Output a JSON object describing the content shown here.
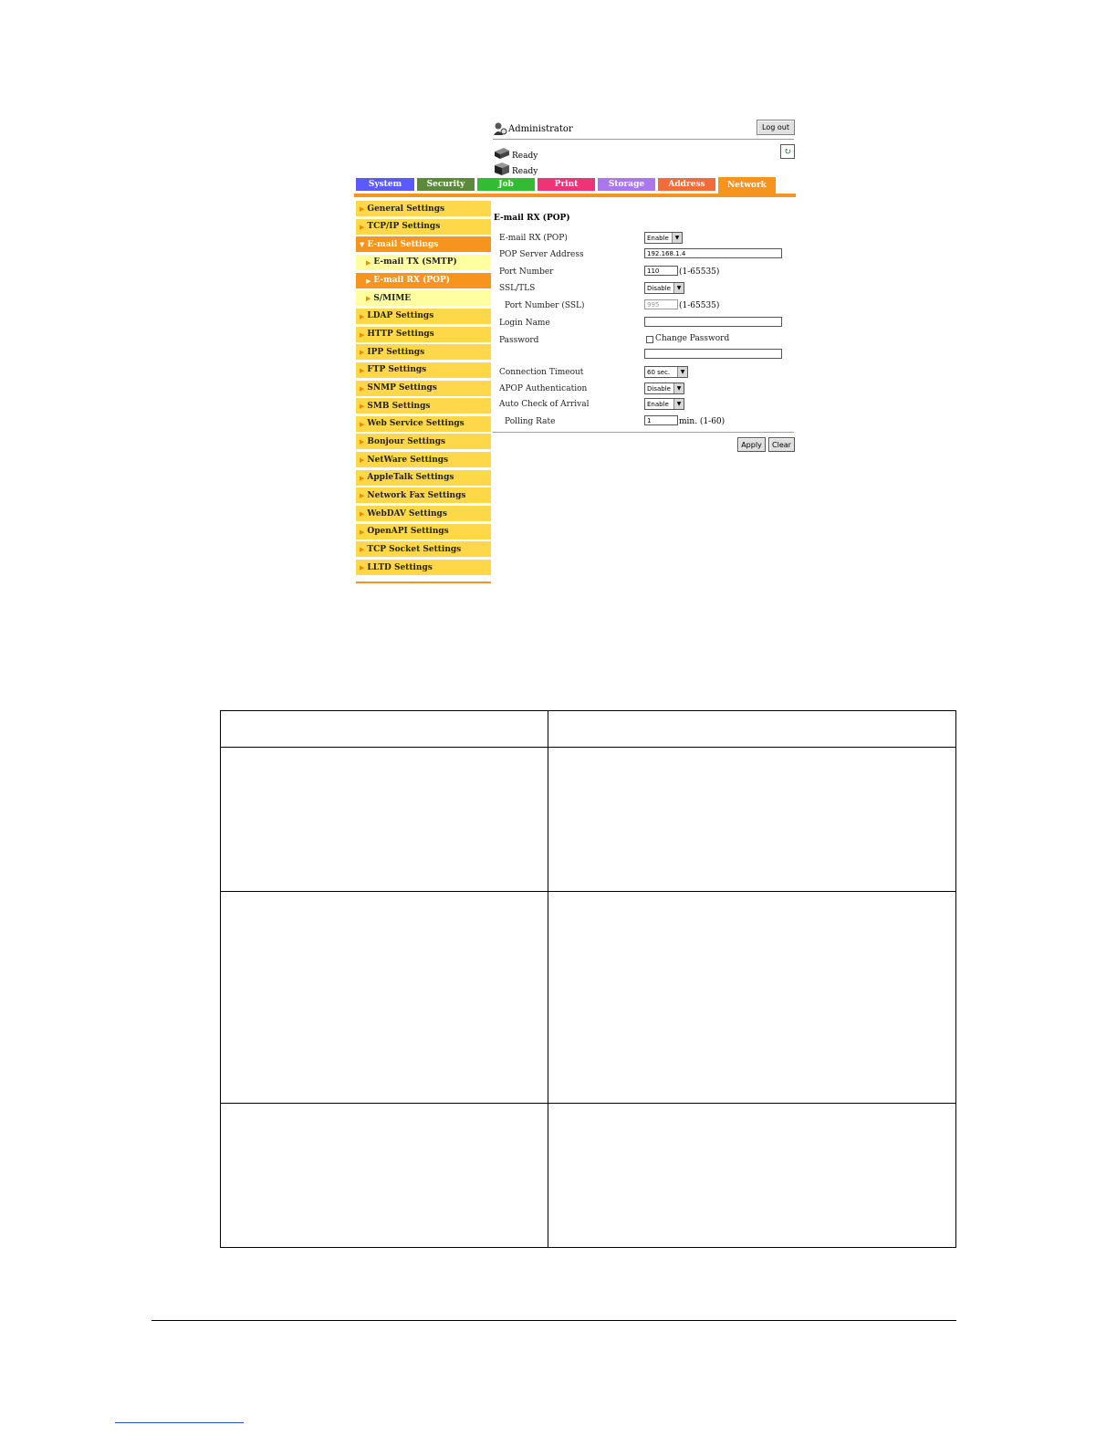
{
  "header": {
    "admin_label": "Administrator",
    "logout_label": "Log out",
    "status_printer": "Ready",
    "status_scanner": "Ready"
  },
  "tabs": [
    {
      "label": "System",
      "color": "#5a5aff"
    },
    {
      "label": "Security",
      "color": "#5a8a3a"
    },
    {
      "label": "Job",
      "color": "#33bb33"
    },
    {
      "label": "Print",
      "color": "#ee3377"
    },
    {
      "label": "Storage",
      "color": "#aa77ee"
    },
    {
      "label": "Address",
      "color": "#f26b3a"
    },
    {
      "label": "Network",
      "color": "#f7941d",
      "active": true
    }
  ],
  "sidebar": {
    "items": [
      {
        "label": "General Settings"
      },
      {
        "label": "TCP/IP Settings"
      },
      {
        "label": "E-mail Settings",
        "open": true
      },
      {
        "label": "E-mail TX (SMTP)",
        "sub": true
      },
      {
        "label": "E-mail RX (POP)",
        "sub": true,
        "active": true
      },
      {
        "label": "S/MIME",
        "sub": true
      },
      {
        "label": "LDAP Settings"
      },
      {
        "label": "HTTP Settings"
      },
      {
        "label": "IPP Settings"
      },
      {
        "label": "FTP Settings"
      },
      {
        "label": "SNMP Settings"
      },
      {
        "label": "SMB Settings"
      },
      {
        "label": "Web Service Settings"
      },
      {
        "label": "Bonjour Settings"
      },
      {
        "label": "NetWare Settings"
      },
      {
        "label": "AppleTalk Settings"
      },
      {
        "label": "Network Fax Settings"
      },
      {
        "label": "WebDAV Settings"
      },
      {
        "label": "OpenAPI Settings"
      },
      {
        "label": "TCP Socket Settings"
      },
      {
        "label": "LLTD Settings"
      }
    ]
  },
  "form": {
    "title": "E-mail RX (POP)",
    "email_rx_label": "E-mail RX (POP)",
    "email_rx_value": "Enable",
    "pop_server_label": "POP Server Address",
    "pop_server_value": "192.168.1.4",
    "port_label": "Port Number",
    "port_value": "110",
    "port_range": "(1-65535)",
    "ssl_label": "SSL/TLS",
    "ssl_value": "Disable",
    "port_ssl_label": "Port Number (SSL)",
    "port_ssl_value": "995",
    "port_ssl_range": "(1-65535)",
    "login_label": "Login Name",
    "login_value": "",
    "password_label": "Password",
    "change_password_label": "Change Password",
    "password_value": "",
    "timeout_label": "Connection Timeout",
    "timeout_value": "60 sec.",
    "apop_label": "APOP Authentication",
    "apop_value": "Disable",
    "auto_check_label": "Auto Check of Arrival",
    "auto_check_value": "Enable",
    "polling_label": "Polling Rate",
    "polling_value": "1",
    "polling_unit": "min. (1-60)",
    "apply_label": "Apply",
    "clear_label": "Clear"
  }
}
